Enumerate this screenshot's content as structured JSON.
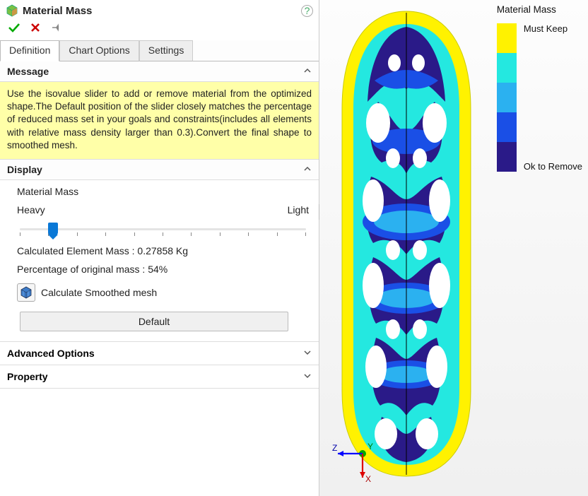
{
  "panel": {
    "title": "Material Mass",
    "help_glyph": "?"
  },
  "tabs": {
    "definition": "Definition",
    "chart_options": "Chart Options",
    "settings": "Settings"
  },
  "sections": {
    "message": {
      "title": "Message",
      "body": "Use the isovalue slider to add or remove material from the optimized shape.The Default  position of the slider closely matches the percentage of reduced mass set in your goals and constraints(includes all elements with relative mass density larger than 0.3).Convert the final shape to smoothed mesh."
    },
    "display": {
      "title": "Display",
      "label": "Material Mass",
      "slider_left": "Heavy",
      "slider_right": "Light",
      "calc_mass": "Calculated Element Mass : 0.27858 Kg",
      "pct_mass": "Percentage of original mass : 54%",
      "smooth_label": "Calculate Smoothed mesh",
      "default_btn": "Default"
    },
    "advanced": {
      "title": "Advanced Options"
    },
    "property": {
      "title": "Property"
    }
  },
  "legend": {
    "title": "Material Mass",
    "top_label": "Must Keep",
    "bottom_label": "Ok to Remove",
    "colors": [
      "#fff200",
      "#24e8e0",
      "#2bb1f0",
      "#1a4fe6",
      "#2a1a88"
    ]
  },
  "triad": {
    "x": "X",
    "y": "Y",
    "z": "Z"
  }
}
